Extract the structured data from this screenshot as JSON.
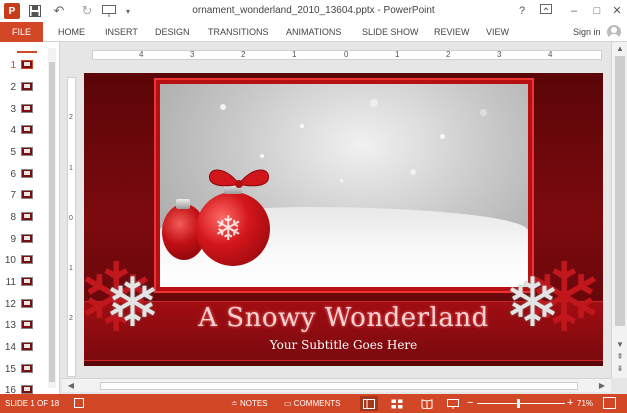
{
  "app": {
    "logo_letter": "P",
    "title": "ornament_wonderland_2010_13604.pptx - PowerPoint",
    "help": "?",
    "min": "–",
    "max": "□",
    "close": "✕"
  },
  "ribbon": {
    "file": "FILE",
    "tabs": [
      "HOME",
      "INSERT",
      "DESIGN",
      "TRANSITIONS",
      "ANIMATIONS",
      "SLIDE SHOW",
      "REVIEW",
      "VIEW"
    ],
    "signin": "Sign in"
  },
  "ruler": {
    "h_ticks": [
      "4",
      "3",
      "2",
      "1",
      "0",
      "1",
      "2",
      "3",
      "4"
    ],
    "v_ticks": [
      "2",
      "1",
      "0",
      "1",
      "2"
    ]
  },
  "thumbnails": {
    "numbers": [
      "1",
      "2",
      "3",
      "4",
      "5",
      "6",
      "7",
      "8",
      "9",
      "10",
      "11",
      "12",
      "13",
      "14",
      "15",
      "16"
    ],
    "selected": "1"
  },
  "slide": {
    "title": "A Snowy Wonderland",
    "subtitle": "Your Subtitle Goes Here",
    "colors": {
      "background": "#7c0a0e",
      "frame": "#b80f14",
      "title_text": "#f7d4d4"
    }
  },
  "status": {
    "slide_counter": "SLIDE 1 OF 18",
    "notes": "NOTES",
    "comments": "COMMENTS",
    "zoom": "71%",
    "active_view": "normal",
    "accent": "#d24726"
  }
}
